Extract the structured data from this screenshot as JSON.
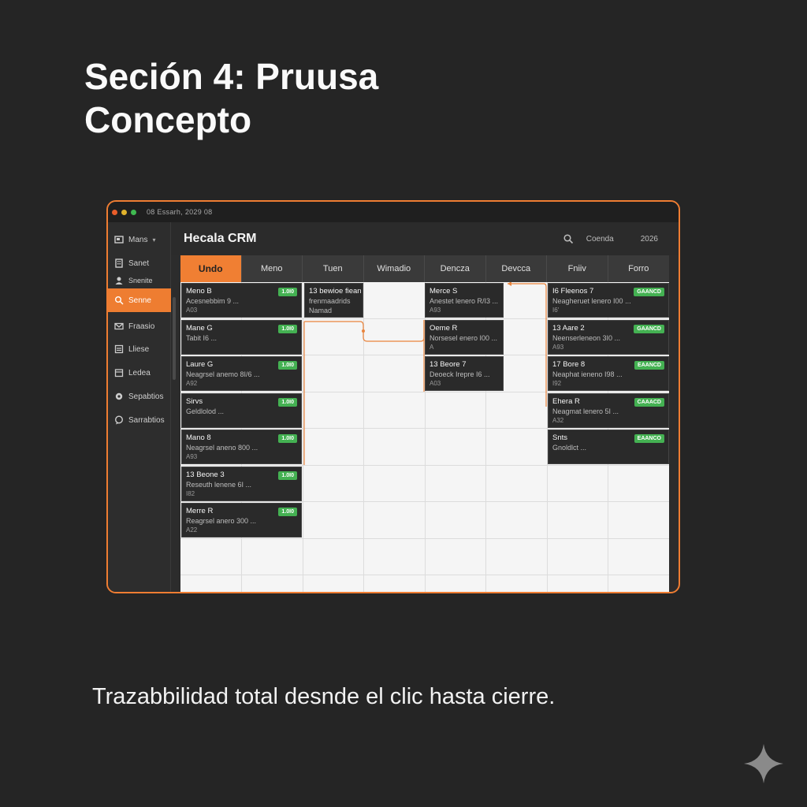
{
  "slide": {
    "title_line1": "Seción 4: Pruusa",
    "title_line2": "Concepto",
    "caption": "Trazabbilidad total desnde el clic hasta cierre."
  },
  "window": {
    "titlebar": "08 Essarh, 2029 08",
    "accent": "#ee7d31"
  },
  "sidebar": {
    "items": [
      {
        "label": "Mans",
        "icon": "box-icon"
      },
      {
        "label": "Sanet",
        "icon": "building-icon"
      },
      {
        "label": "Snenite",
        "icon": "user-icon"
      },
      {
        "label": "Senne",
        "icon": "search-icon"
      },
      {
        "label": "Fraasio",
        "icon": "mail-icon"
      },
      {
        "label": "Lliese",
        "icon": "list-icon"
      },
      {
        "label": "Ledea",
        "icon": "calendar-icon"
      },
      {
        "label": "Sepabtios",
        "icon": "gear-icon"
      },
      {
        "label": "Sarrabtios",
        "icon": "chat-icon"
      }
    ]
  },
  "header": {
    "app_title": "Hecala CRM",
    "link": "Coenda",
    "year": "2026"
  },
  "tabs": [
    "Undo",
    "Meno",
    "Tuen",
    "Wimadio",
    "Dencza",
    "Devcca",
    "Fniiv",
    "Forro"
  ],
  "cards": {
    "col0": [
      {
        "title": "Meno B",
        "desc": "Acesnebbim 9 ...",
        "code": "A03",
        "badge": "1.0I0"
      },
      {
        "title": "Mane G",
        "desc": "Tabit I6 ...",
        "code": "",
        "badge": "1.0I0"
      },
      {
        "title": "Laure G",
        "desc": "Neagrsel anemo 8I/6 ...",
        "code": "A92",
        "badge": "1.0I0"
      },
      {
        "title": "Sirvs",
        "desc": "Geldlolod ...",
        "code": "",
        "badge": "1.0I0"
      },
      {
        "title": "Mano 8",
        "desc": "Neagrsel aneno 800 ...",
        "code": "A93",
        "badge": "1.0I0"
      },
      {
        "title": "13 Beone 3",
        "desc": "Reseuth lenene 6I ...",
        "code": "I82",
        "badge": "1.0I0"
      },
      {
        "title": "Merre R",
        "desc": "Reagrsel anero 300 ...",
        "code": "A22",
        "badge": "1.0I0"
      }
    ],
    "col2": [
      {
        "title": "13 bewioe fiean",
        "desc": "frenmaadrids",
        "code": "Namad"
      }
    ],
    "col4": [
      {
        "title": "Merce S",
        "desc": "Anestet lenero R/I3 ...",
        "code": "A93"
      },
      {
        "title": "Oeme R",
        "desc": "Norsesel enero I00 ...",
        "code": "A"
      },
      {
        "title": "13 Beore 7",
        "desc": "Deoeck Irepre I6 ...",
        "code": "A03"
      }
    ],
    "col6": [
      {
        "title": "I6 Fleenos 7",
        "desc": "Neagheruet lenero I00 ...",
        "code": "I6'",
        "badge": "GAANCD"
      },
      {
        "title": "13 Aare 2",
        "desc": "Neenserleneon 3I0 ...",
        "code": "A93",
        "badge": "GAANCD"
      },
      {
        "title": "17 Bore 8",
        "desc": "Neaphat ieneno I98 ...",
        "code": "I92",
        "badge": "EAANCD"
      },
      {
        "title": "Ehera R",
        "desc": "Neagmat lenero 5I ...",
        "code": "A32",
        "badge": "CAAACD"
      },
      {
        "title": "Snts",
        "desc": "Gnoldlct ...",
        "code": "",
        "badge": "EAANCO"
      }
    ]
  },
  "colors": {
    "accent": "#ee7d31",
    "badge": "#44b152",
    "background": "#252525"
  }
}
